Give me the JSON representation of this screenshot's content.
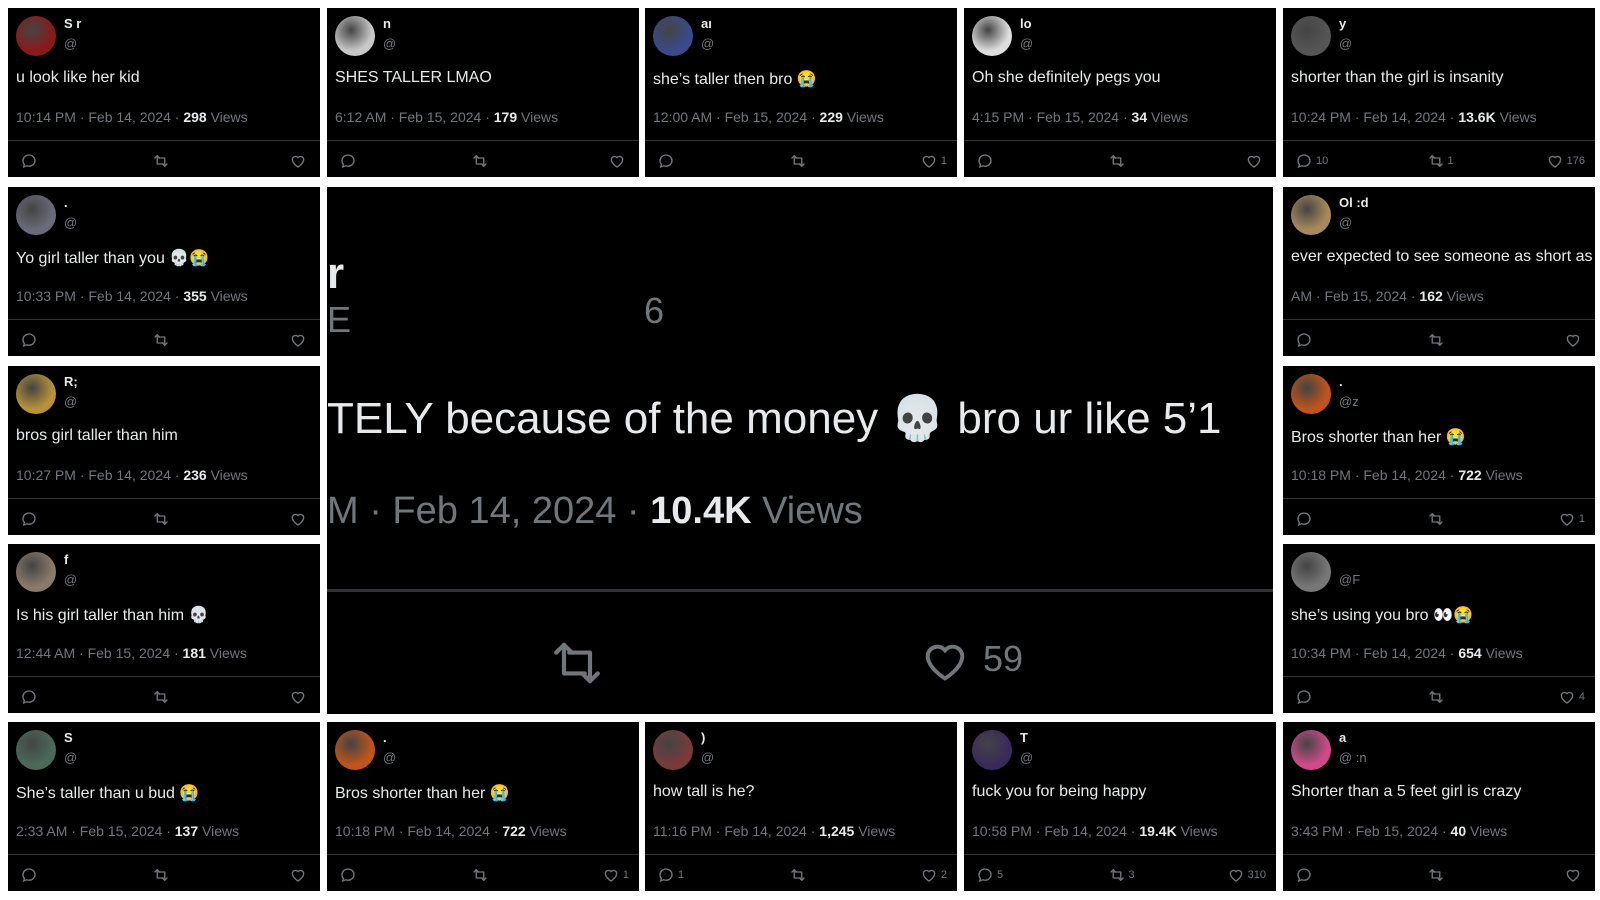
{
  "collage": {
    "center_tweet": {
      "fragment_top": "r",
      "fragment_mid": "E",
      "fragment_num": "6",
      "text": "TELY because of the money 💀 bro ur like 5’1",
      "time": "M · Feb 14, 2024 · ",
      "views_count": "10.4K",
      "views_label": " Views",
      "likes": "59"
    },
    "tweets": [
      {
        "name": "S          r",
        "handle": "@",
        "text": "u look like her kid",
        "time": "10:14 PM · Feb 14, 2024 · ",
        "views": "298",
        "views_label": " Views",
        "replies": "",
        "retweets": "",
        "likes": "",
        "avatar_color": "#8a1a1a"
      },
      {
        "name": "n",
        "handle": "@",
        "text": "SHES TALLER LMAO",
        "time": "6:12 AM · Feb 15, 2024 · ",
        "views": "179",
        "views_label": " Views",
        "replies": "",
        "retweets": "",
        "likes": "",
        "avatar_color": "#c8c8c8"
      },
      {
        "name": "aı",
        "handle": "@",
        "text": "she’s taller then bro 😭",
        "time": "12:00 AM · Feb 15, 2024 · ",
        "views": "229",
        "views_label": " Views",
        "replies": "",
        "retweets": "",
        "likes": "1",
        "avatar_color": "#3a4a8a"
      },
      {
        "name": "lo",
        "handle": "@",
        "text": "Oh she definitely pegs you",
        "time": "4:15 PM · Feb 15, 2024 · ",
        "views": "34",
        "views_label": " Views",
        "replies": "",
        "retweets": "",
        "likes": "",
        "avatar_color": "#dddddd"
      },
      {
        "name": "y",
        "handle": "@",
        "text": "shorter than the girl is insanity",
        "time": "10:24 PM · Feb 14, 2024 · ",
        "views": "13.6K",
        "views_label": " Views",
        "replies": "10",
        "retweets": "1",
        "likes": "176",
        "avatar_color": "#555555"
      },
      {
        "name": ".",
        "handle": "@",
        "text": "Yo girl taller than you 💀😭",
        "time": "10:33 PM · Feb 14, 2024 · ",
        "views": "355",
        "views_label": " Views",
        "replies": "",
        "retweets": "",
        "likes": "",
        "avatar_color": "#6a6a7a"
      },
      {
        "name": "Ol            :d",
        "handle": "@",
        "text": "ever expected to see someone as short as Du",
        "time": "AM · Feb 15, 2024 · ",
        "views": "162",
        "views_label": " Views",
        "replies": "",
        "retweets": "",
        "likes": "",
        "avatar_color": "#a88a5a"
      },
      {
        "name": "R;",
        "handle": "@",
        "text": "bros girl taller than him",
        "time": "10:27 PM · Feb 14, 2024 · ",
        "views": "236",
        "views_label": " Views",
        "replies": "",
        "retweets": "",
        "likes": "",
        "avatar_color": "#b8923a"
      },
      {
        "name": ".",
        "handle": "@z",
        "text": "Bros shorter than her 😭",
        "time": "10:18 PM · Feb 14, 2024 · ",
        "views": "722",
        "views_label": " Views",
        "replies": "",
        "retweets": "",
        "likes": "1",
        "avatar_color": "#c0541a"
      },
      {
        "name": "f",
        "handle": "@",
        "text": "Is his girl taller than him 💀",
        "time": "12:44 AM · Feb 15, 2024 · ",
        "views": "181",
        "views_label": " Views",
        "replies": "",
        "retweets": "",
        "likes": "",
        "avatar_color": "#8a7a6a"
      },
      {
        "name": "",
        "handle": "@F",
        "text": "she’s using you bro 👀😭",
        "time": "10:34 PM · Feb 14, 2024 · ",
        "views": "654",
        "views_label": " Views",
        "replies": "",
        "retweets": "",
        "likes": "4",
        "avatar_color": "#777777"
      },
      {
        "name": "S",
        "handle": "@",
        "text": "She’s taller than u bud 😭",
        "time": "2:33 AM · Feb 15, 2024 · ",
        "views": "137",
        "views_label": " Views",
        "replies": "",
        "retweets": "",
        "likes": "",
        "avatar_color": "#4a6a5a"
      },
      {
        "name": ".",
        "handle": "@",
        "text": "Bros shorter than her 😭",
        "time": "10:18 PM · Feb 14, 2024 · ",
        "views": "722",
        "views_label": " Views",
        "replies": "",
        "retweets": "",
        "likes": "1",
        "avatar_color": "#c0541a"
      },
      {
        "name": ")",
        "handle": "@",
        "text": "how tall is he?",
        "time": "11:16 PM · Feb 14, 2024 · ",
        "views": "1,245",
        "views_label": " Views",
        "replies": "1",
        "retweets": "",
        "likes": "2",
        "avatar_color": "#7a3a3a"
      },
      {
        "name": "T",
        "handle": "@",
        "text": "fuck you for being happy",
        "time": "10:58 PM · Feb 14, 2024 · ",
        "views": "19.4K",
        "views_label": " Views",
        "replies": "5",
        "retweets": "3",
        "likes": "310",
        "avatar_color": "#3a2a5a"
      },
      {
        "name": "a",
        "handle": "@           :n",
        "text": "Shorter than a 5 feet girl is crazy",
        "time": "3:43 PM · Feb 15, 2024 · ",
        "views": "40",
        "views_label": " Views",
        "replies": "",
        "retweets": "",
        "likes": "",
        "avatar_color": "#d04a8a"
      }
    ]
  }
}
